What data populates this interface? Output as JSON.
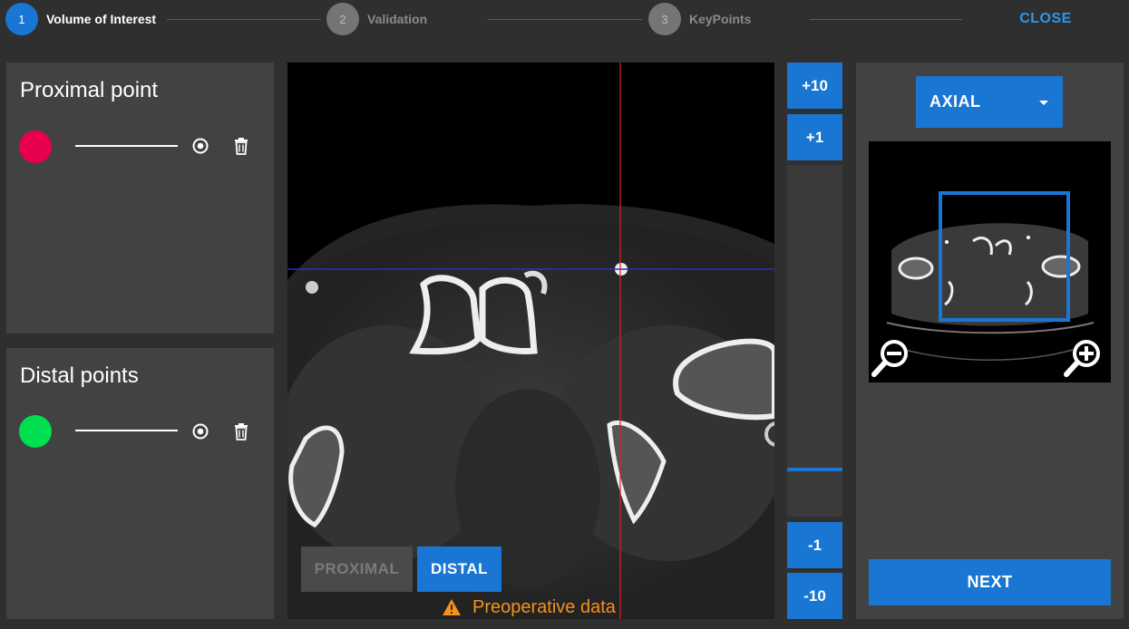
{
  "stepper": {
    "steps": [
      {
        "number": "1",
        "label": "Volume of Interest"
      },
      {
        "number": "2",
        "label": "Validation"
      },
      {
        "number": "3",
        "label": "KeyPoints"
      }
    ],
    "close_label": "CLOSE"
  },
  "proximal": {
    "title": "Proximal point",
    "color": "#e8004f"
  },
  "distal": {
    "title": "Distal points",
    "color": "#00e04f"
  },
  "viewer": {
    "proximal_label": "PROXIMAL",
    "distal_label": "DISTAL",
    "warning": "Preoperative data"
  },
  "slice": {
    "plus10": "+10",
    "plus1": "+1",
    "minus1": "-1",
    "minus10": "-10",
    "position": 0.87
  },
  "view_select": {
    "value": "AXIAL"
  },
  "next_label": "NEXT",
  "colors": {
    "accent": "#1976d2",
    "warning": "#f5911f",
    "close": "#2b97f0"
  }
}
